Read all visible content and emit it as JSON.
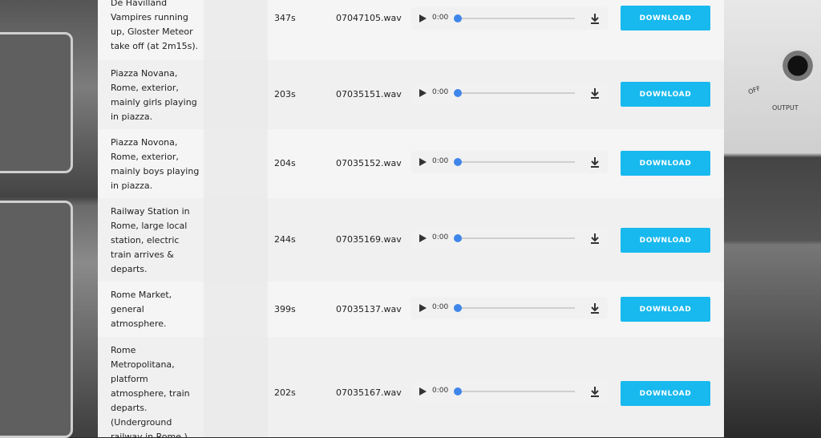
{
  "colors": {
    "accent": "#17b9ee",
    "progress_thumb": "#3f86ea"
  },
  "rows": [
    {
      "description": "De Havilland Vampires running up, Gloster Meteor take off (at 2m15s).",
      "duration": "347s",
      "file": "07047105.wav",
      "time": "0:00",
      "button": "DOWNLOAD"
    },
    {
      "description": "Piazza Novana, Rome, exterior, mainly girls playing in piazza.",
      "duration": "203s",
      "file": "07035151.wav",
      "time": "0:00",
      "button": "DOWNLOAD"
    },
    {
      "description": "Piazza Novona, Rome, exterior, mainly boys playing in piazza.",
      "duration": "204s",
      "file": "07035152.wav",
      "time": "0:00",
      "button": "DOWNLOAD"
    },
    {
      "description": "Railway Station in Rome, large local station, electric train arrives & departs.",
      "duration": "244s",
      "file": "07035169.wav",
      "time": "0:00",
      "button": "DOWNLOAD"
    },
    {
      "description": "Rome Market, general atmosphere.",
      "duration": "399s",
      "file": "07035137.wav",
      "time": "0:00",
      "button": "DOWNLOAD"
    },
    {
      "description": "Rome Metropolitana, platform atmosphere, train departs. (Underground railway in Rome.)",
      "duration": "202s",
      "file": "07035167.wav",
      "time": "0:00",
      "button": "DOWNLOAD"
    }
  ],
  "icons": {
    "play": "play-icon",
    "download": "download-arrow-icon"
  },
  "background": {
    "dial_labels": [
      "OFF",
      "OUTPUT"
    ]
  }
}
